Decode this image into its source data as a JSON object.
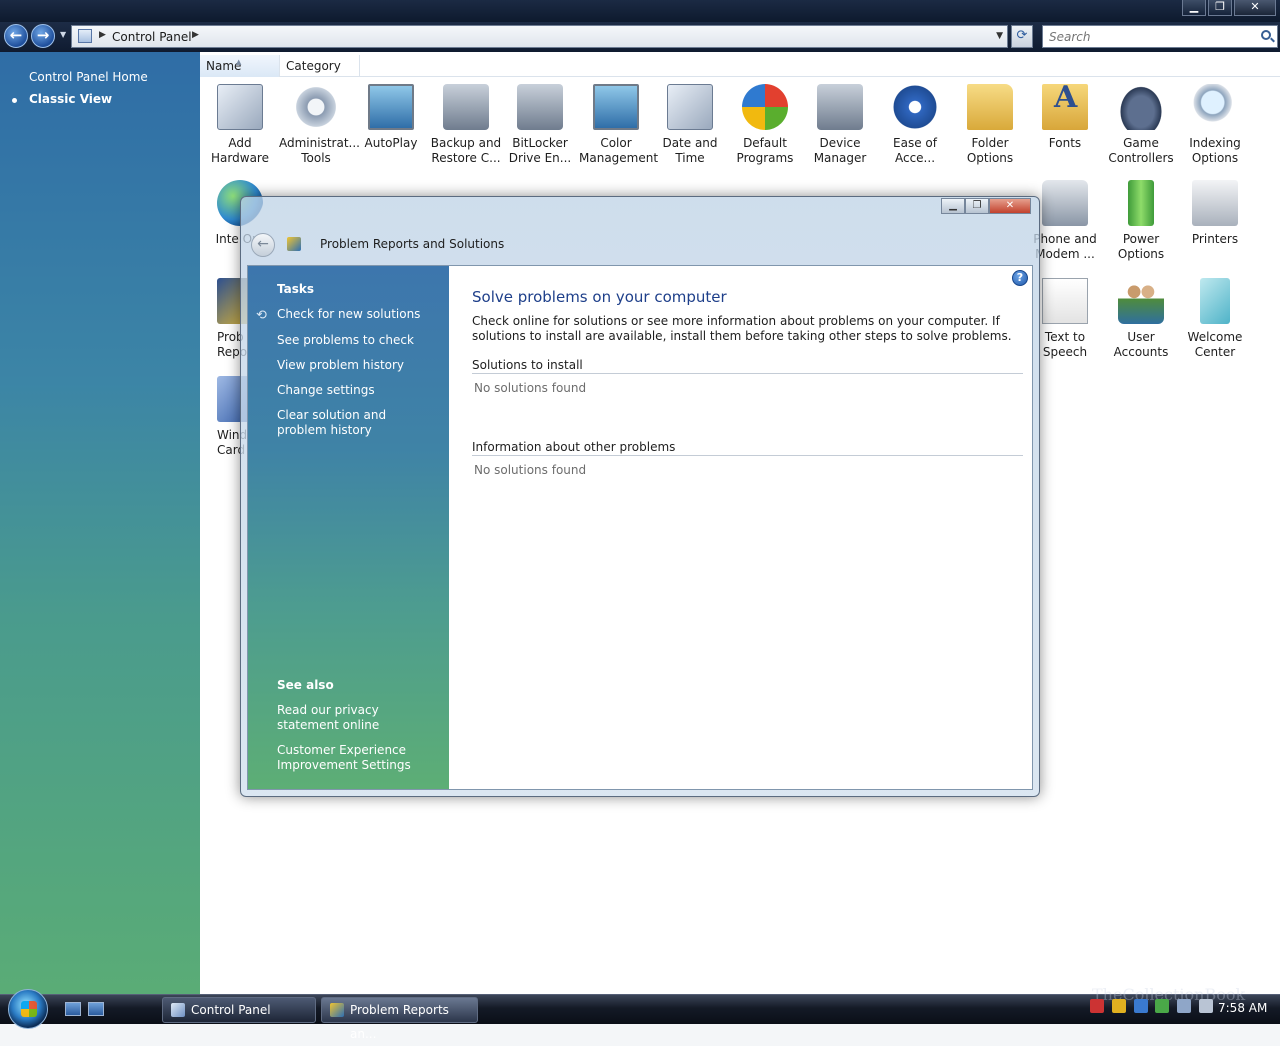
{
  "window": {
    "minimize": "▁",
    "restore": "❐",
    "close": "✕"
  },
  "nav": {
    "back": "←",
    "forward": "→",
    "breadcrumb": "Control Panel",
    "search_placeholder": "Search"
  },
  "left_nav": {
    "home": "Control Panel Home",
    "classic": "Classic View"
  },
  "columns": {
    "name": "Name",
    "category": "Category"
  },
  "items": [
    {
      "label": "Add Hardware",
      "icon": "add-hardware-icon"
    },
    {
      "label": "Administrat... Tools",
      "icon": "administrative-tools-icon"
    },
    {
      "label": "AutoPlay",
      "icon": "autoplay-icon"
    },
    {
      "label": "Backup and Restore C...",
      "icon": "backup-icon"
    },
    {
      "label": "BitLocker Drive En...",
      "icon": "bitlocker-icon"
    },
    {
      "label": "Color Management",
      "icon": "color-management-icon"
    },
    {
      "label": "Date and Time",
      "icon": "date-time-icon"
    },
    {
      "label": "Default Programs",
      "icon": "default-programs-icon"
    },
    {
      "label": "Device Manager",
      "icon": "device-manager-icon"
    },
    {
      "label": "Ease of Acce...",
      "icon": "ease-of-access-icon"
    },
    {
      "label": "Folder Options",
      "icon": "folder-options-icon"
    },
    {
      "label": "Fonts",
      "icon": "fonts-icon"
    },
    {
      "label": "Game Controllers",
      "icon": "game-controllers-icon"
    },
    {
      "label": "Indexing Options",
      "icon": "indexing-options-icon"
    },
    {
      "label": "Inte Opt",
      "icon": "internet-options-icon"
    },
    {
      "label": "Phone and Modem ...",
      "icon": "phone-modem-icon"
    },
    {
      "label": "Power Options",
      "icon": "power-options-icon"
    },
    {
      "label": "Printers",
      "icon": "printers-icon"
    },
    {
      "label": "Prob Repo",
      "icon": "problem-reports-icon"
    },
    {
      "label": "Text to Speech",
      "icon": "text-to-speech-icon"
    },
    {
      "label": "User Accounts",
      "icon": "user-accounts-icon"
    },
    {
      "label": "Welcome Center",
      "icon": "welcome-center-icon"
    },
    {
      "label": "Wind Card",
      "icon": "windows-cardspace-icon"
    }
  ],
  "dialog": {
    "title": "Problem Reports and Solutions",
    "help": "?",
    "tasks_header": "Tasks",
    "tasks": [
      "Check for new solutions",
      "See problems to check",
      "View problem history",
      "Change settings",
      "Clear solution and problem history"
    ],
    "see_also_header": "See also",
    "see_also": [
      "Read our privacy statement online",
      "Customer Experience Improvement Settings"
    ],
    "main_title": "Solve problems on your computer",
    "description": "Check online for solutions or see more information about problems on your computer. If solutions to install are available, install them before taking other steps to solve problems.",
    "section1_title": "Solutions to install",
    "section1_value": "No solutions found",
    "section2_title": "Information about other problems",
    "section2_value": "No solutions found"
  },
  "taskbar": {
    "buttons": [
      "Control Panel",
      "Problem Reports an..."
    ],
    "time": "7:58 AM",
    "watermark": "TheCollectionBook"
  }
}
